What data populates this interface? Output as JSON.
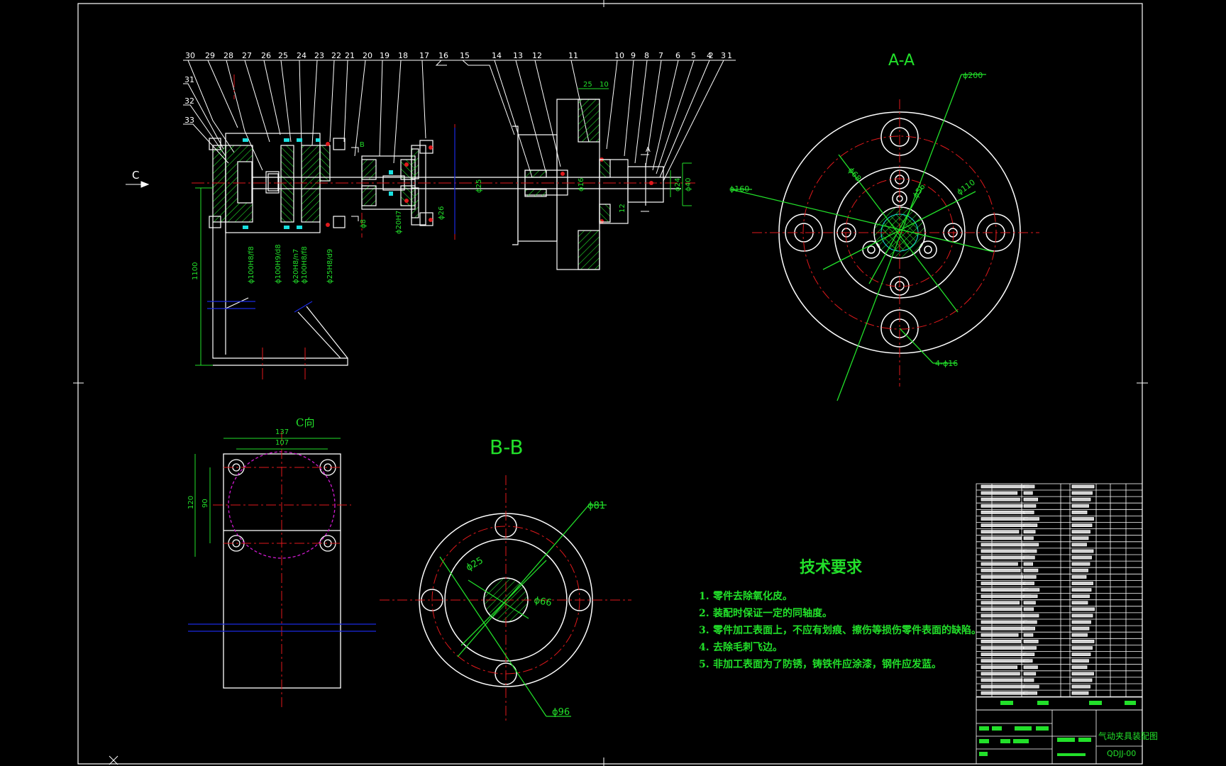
{
  "drawing": {
    "balloons": [
      "30",
      "29",
      "28",
      "27",
      "26",
      "25",
      "24",
      "23",
      "22",
      "21",
      "20",
      "19",
      "18",
      "17",
      "16",
      "15",
      "14",
      "13",
      "12",
      "11",
      "10",
      "9",
      "8",
      "7",
      "6",
      "5",
      "4",
      "3",
      "2",
      "1"
    ],
    "side_balloons": [
      "31",
      "32",
      "33"
    ],
    "view_arrow_c": "C",
    "section_b_mark": "B",
    "section_a_mark": "A",
    "main_view_dims": {
      "d25_top": "25",
      "d10_top": "10",
      "phi25": "ϕ25",
      "phi16": "ϕ16",
      "phi24": "ϕ24",
      "phi40": "ϕ40",
      "len12": "12",
      "height1100": "1100",
      "fit1": "ϕ100H8/f8",
      "fit2": "ϕ100H9/d8",
      "fit3": "ϕ20H8/n7",
      "fit4": "ϕ100H8/f8",
      "fit5": "ϕ25H8/d9",
      "fit6": "ϕ20H7",
      "fit7": "ϕ26",
      "fit8": "ϕ8"
    },
    "section_aa": {
      "title": "A-A",
      "dims": [
        "ϕ200",
        "ϕ160",
        "ϕ110",
        "ϕ56",
        "ϕ68"
      ],
      "holes": "4-ϕ16"
    },
    "view_c": {
      "title": "C向",
      "w1": "137",
      "w2": "107",
      "h1": "120",
      "h2": "90"
    },
    "section_bb": {
      "title": "B-B",
      "dims": [
        "ϕ81",
        "ϕ25",
        "ϕ66",
        "ϕ96"
      ]
    }
  },
  "tech_requirements": {
    "title": "技术要求",
    "items": [
      {
        "num": "1.",
        "text": "零件去除氧化皮。"
      },
      {
        "num": "2.",
        "text": "装配时保证一定的同轴度。"
      },
      {
        "num": "3.",
        "text": "零件加工表面上，不应有划痕、擦伤等损伤零件表面的缺陷。"
      },
      {
        "num": "4.",
        "text": "去除毛刺飞边。"
      },
      {
        "num": "5.",
        "text": "非加工表面为了防锈，铸铁件应涂漆，钢件应发蓝。"
      }
    ]
  },
  "title_block": {
    "drawing_name": "气动夹具装配图",
    "drawing_code": "QDJJ-00"
  },
  "colors": {
    "outline": "#ffffff",
    "dimension": "#22e02a",
    "centerline": "#e0191c",
    "hatch": "#22e02a",
    "hidden": "#d01ad0",
    "cyan": "#19e0e0",
    "blue": "#1a2ae0"
  }
}
